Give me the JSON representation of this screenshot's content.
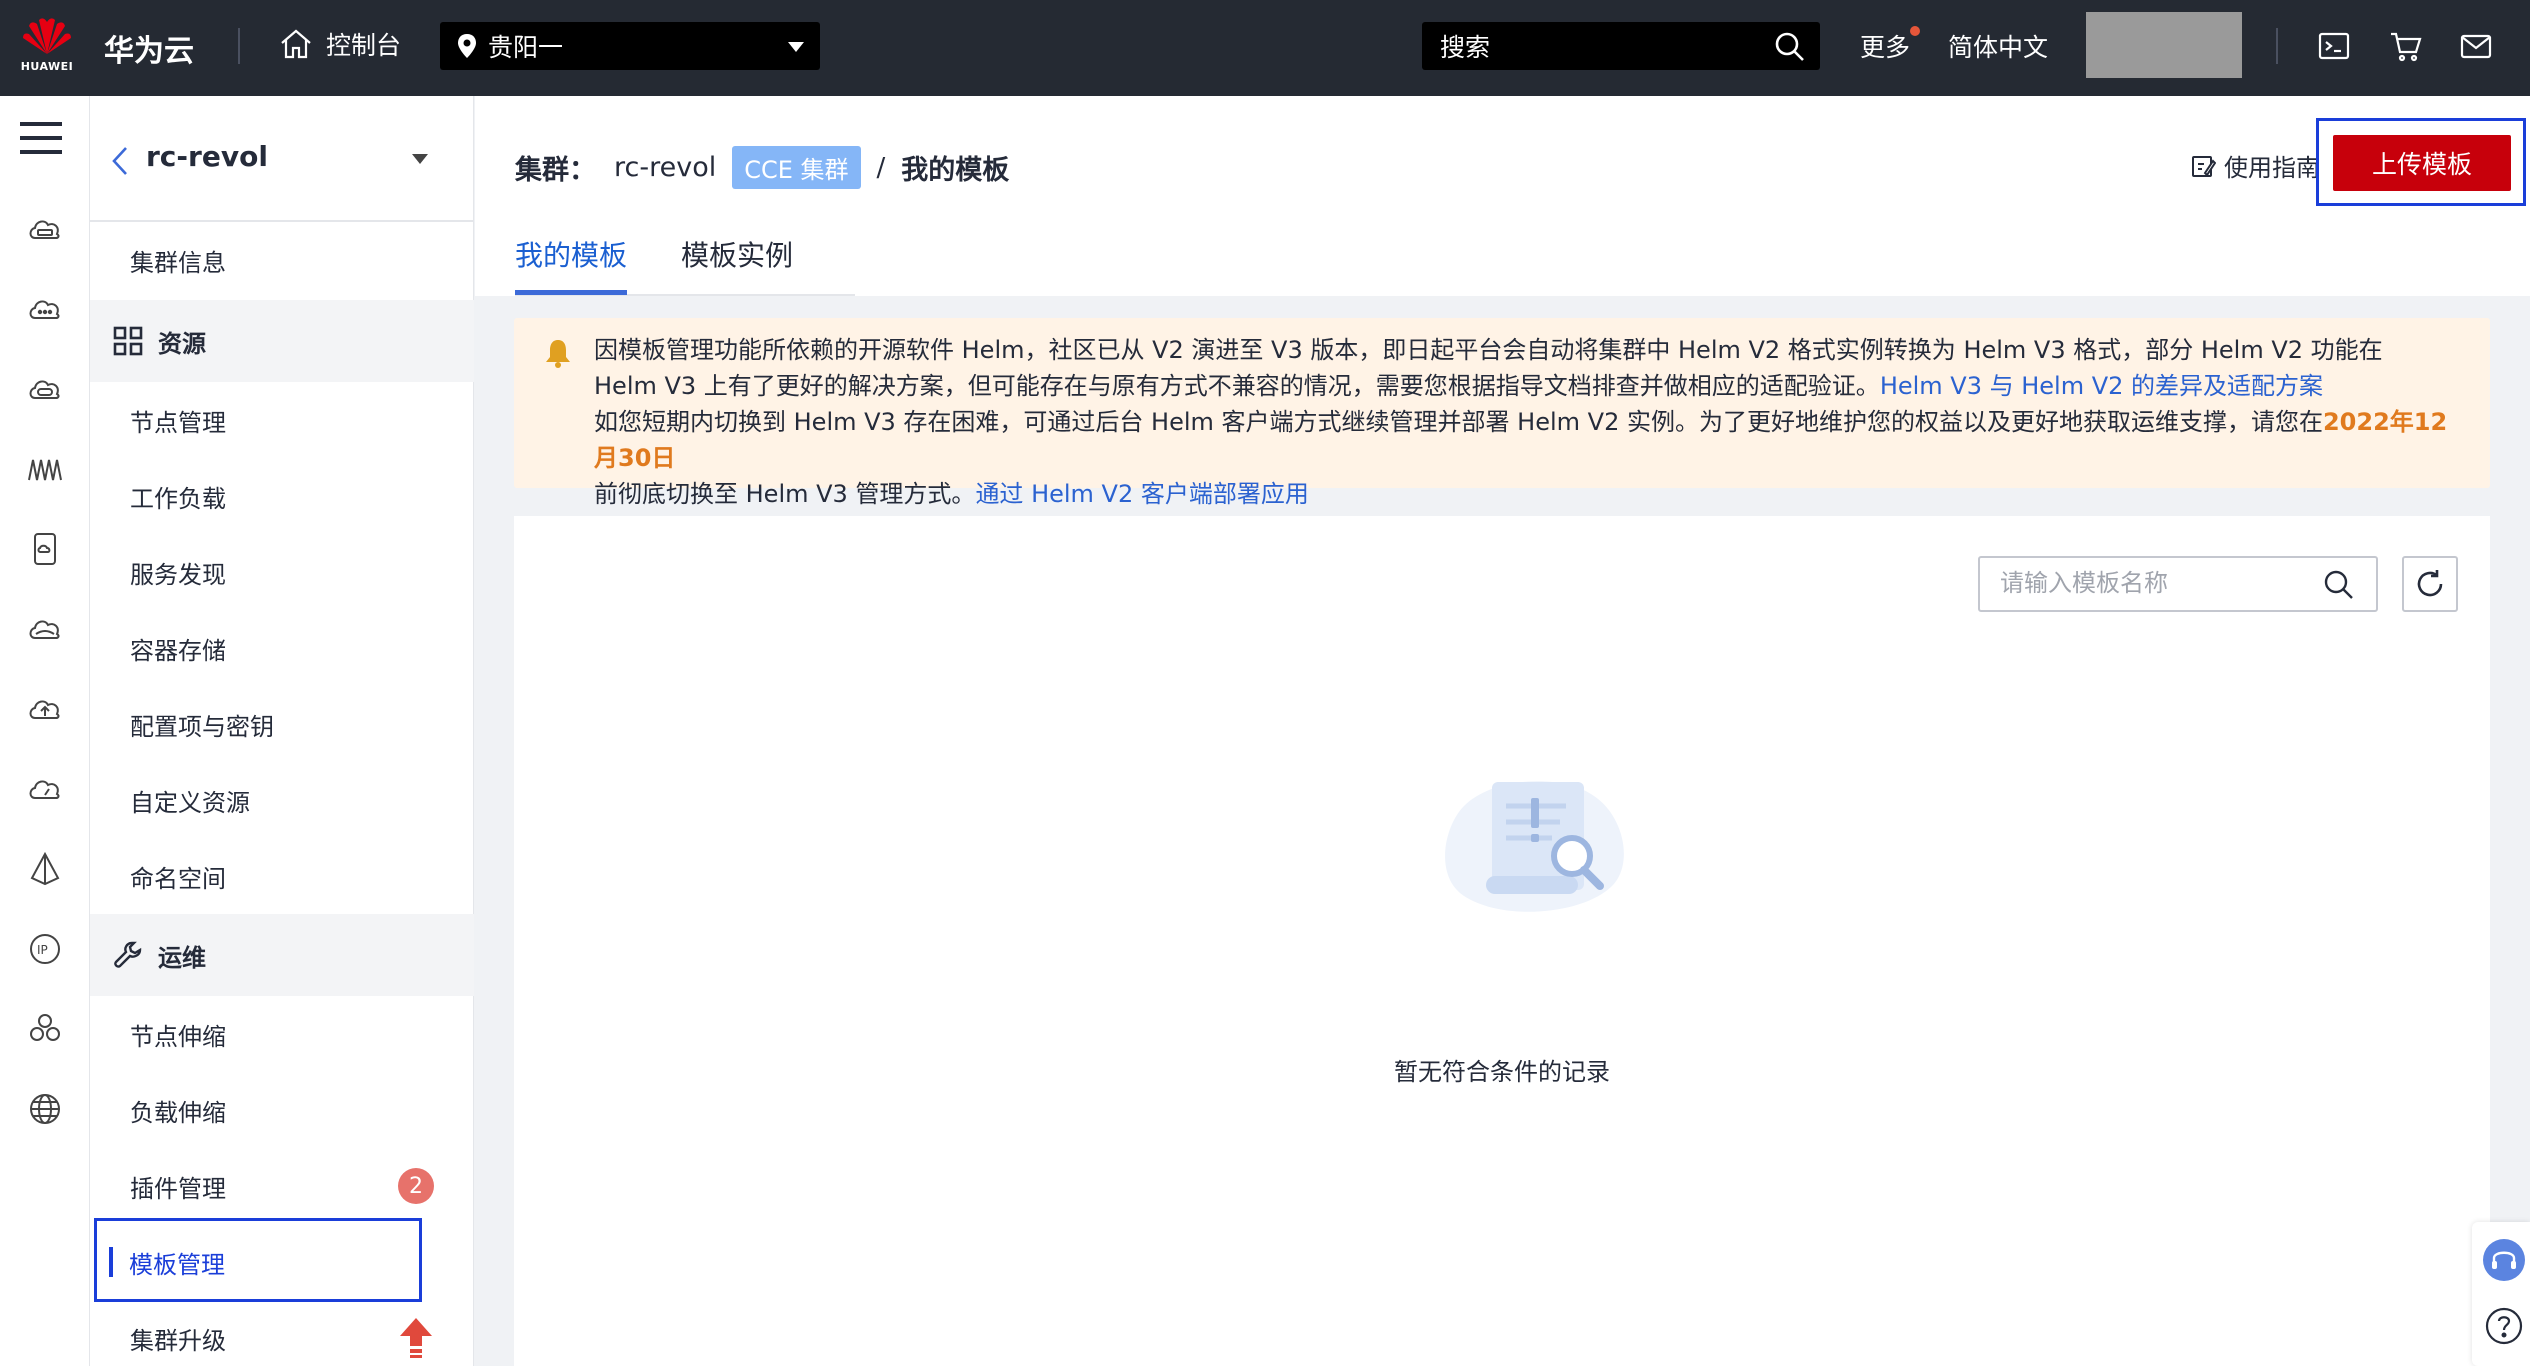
{
  "topbar": {
    "logo_text": "HUAWEI",
    "brand": "华为云",
    "console": "控制台",
    "region": "贵阳一",
    "search_placeholder": "搜索",
    "more": "更多",
    "language": "简体中文"
  },
  "nav": {
    "cluster_name": "rc-revol",
    "items": {
      "cluster_info": "集群信息",
      "group_resources": "资源",
      "node_mgmt": "节点管理",
      "workload": "工作负载",
      "service_discovery": "服务发现",
      "storage": "容器存储",
      "config_secret": "配置项与密钥",
      "custom_resource": "自定义资源",
      "namespace": "命名空间",
      "group_ops": "运维",
      "node_scaling": "节点伸缩",
      "load_scaling": "负载伸缩",
      "addon_mgmt": "插件管理",
      "addon_badge": "2",
      "template_mgmt": "模板管理",
      "cluster_upgrade": "集群升级"
    }
  },
  "page": {
    "crumb_key": "集群：",
    "crumb_cluster": "rc-revol",
    "crumb_tag": "CCE 集群",
    "crumb_sep": "/",
    "crumb_current": "我的模板",
    "guide": "使用指南",
    "upload": "上传模板",
    "tabs": [
      "我的模板",
      "模板实例"
    ]
  },
  "notice": {
    "p1": "因模板管理功能所依赖的开源软件 Helm，社区已从 V2 演进至 V3 版本，即日起平台会自动将集群中 Helm V2 格式实例转换为 Helm V3 格式，部分 Helm V2 功能在 Helm V3 上有了更好的解决方案，但可能存在与原有方式不兼容的情况，需要您根据指导文档排查并做相应的适配验证。",
    "link1": "Helm V3 与 Helm V2 的差异及适配方案",
    "p2": "如您短期内切换到 Helm V3 存在困难，可通过后台 Helm 客户端方式继续管理并部署 Helm V2 实例。为了更好地维护您的权益以及更好地获取运维支撑，请您在",
    "date": "2022年12月30日",
    "p3": "前彻底切换至 Helm V3 管理方式。",
    "link2": "通过 Helm V2 客户端部署应用"
  },
  "content": {
    "search_placeholder": "请输入模板名称",
    "empty_text": "暂无符合条件的记录"
  },
  "colors": {
    "topbar_bg": "#252a33",
    "primary_red": "#c7000b",
    "link_blue": "#2b62d0",
    "highlight_border": "#1a3ed9",
    "notice_bg": "#fff3e6",
    "date_orange": "#e07a1e"
  },
  "icons": [
    "huawei-logo-icon",
    "home-icon",
    "location-pin-icon",
    "search-icon",
    "terminal-icon",
    "cart-icon",
    "mail-icon",
    "menu-icon",
    "grid-icon",
    "wrench-icon",
    "bell-icon",
    "refresh-icon",
    "guide-icon",
    "upgrade-arrow-icon",
    "headset-icon",
    "help-icon"
  ]
}
